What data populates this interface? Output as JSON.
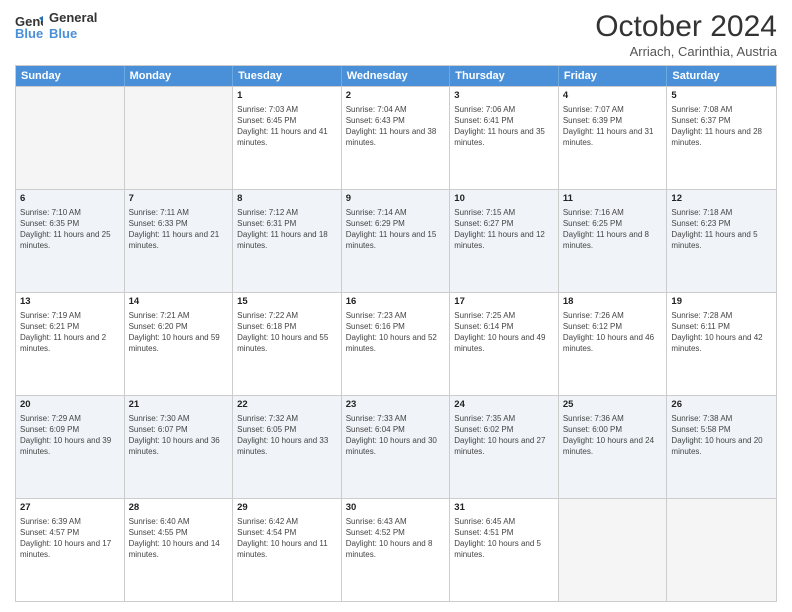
{
  "header": {
    "logo_line1": "General",
    "logo_line2": "Blue",
    "month": "October 2024",
    "location": "Arriach, Carinthia, Austria"
  },
  "weekdays": [
    "Sunday",
    "Monday",
    "Tuesday",
    "Wednesday",
    "Thursday",
    "Friday",
    "Saturday"
  ],
  "rows": [
    [
      {
        "day": "",
        "info": "",
        "empty": true
      },
      {
        "day": "",
        "info": "",
        "empty": true
      },
      {
        "day": "1",
        "info": "Sunrise: 7:03 AM\nSunset: 6:45 PM\nDaylight: 11 hours and 41 minutes."
      },
      {
        "day": "2",
        "info": "Sunrise: 7:04 AM\nSunset: 6:43 PM\nDaylight: 11 hours and 38 minutes."
      },
      {
        "day": "3",
        "info": "Sunrise: 7:06 AM\nSunset: 6:41 PM\nDaylight: 11 hours and 35 minutes."
      },
      {
        "day": "4",
        "info": "Sunrise: 7:07 AM\nSunset: 6:39 PM\nDaylight: 11 hours and 31 minutes."
      },
      {
        "day": "5",
        "info": "Sunrise: 7:08 AM\nSunset: 6:37 PM\nDaylight: 11 hours and 28 minutes."
      }
    ],
    [
      {
        "day": "6",
        "info": "Sunrise: 7:10 AM\nSunset: 6:35 PM\nDaylight: 11 hours and 25 minutes."
      },
      {
        "day": "7",
        "info": "Sunrise: 7:11 AM\nSunset: 6:33 PM\nDaylight: 11 hours and 21 minutes."
      },
      {
        "day": "8",
        "info": "Sunrise: 7:12 AM\nSunset: 6:31 PM\nDaylight: 11 hours and 18 minutes."
      },
      {
        "day": "9",
        "info": "Sunrise: 7:14 AM\nSunset: 6:29 PM\nDaylight: 11 hours and 15 minutes."
      },
      {
        "day": "10",
        "info": "Sunrise: 7:15 AM\nSunset: 6:27 PM\nDaylight: 11 hours and 12 minutes."
      },
      {
        "day": "11",
        "info": "Sunrise: 7:16 AM\nSunset: 6:25 PM\nDaylight: 11 hours and 8 minutes."
      },
      {
        "day": "12",
        "info": "Sunrise: 7:18 AM\nSunset: 6:23 PM\nDaylight: 11 hours and 5 minutes."
      }
    ],
    [
      {
        "day": "13",
        "info": "Sunrise: 7:19 AM\nSunset: 6:21 PM\nDaylight: 11 hours and 2 minutes."
      },
      {
        "day": "14",
        "info": "Sunrise: 7:21 AM\nSunset: 6:20 PM\nDaylight: 10 hours and 59 minutes."
      },
      {
        "day": "15",
        "info": "Sunrise: 7:22 AM\nSunset: 6:18 PM\nDaylight: 10 hours and 55 minutes."
      },
      {
        "day": "16",
        "info": "Sunrise: 7:23 AM\nSunset: 6:16 PM\nDaylight: 10 hours and 52 minutes."
      },
      {
        "day": "17",
        "info": "Sunrise: 7:25 AM\nSunset: 6:14 PM\nDaylight: 10 hours and 49 minutes."
      },
      {
        "day": "18",
        "info": "Sunrise: 7:26 AM\nSunset: 6:12 PM\nDaylight: 10 hours and 46 minutes."
      },
      {
        "day": "19",
        "info": "Sunrise: 7:28 AM\nSunset: 6:11 PM\nDaylight: 10 hours and 42 minutes."
      }
    ],
    [
      {
        "day": "20",
        "info": "Sunrise: 7:29 AM\nSunset: 6:09 PM\nDaylight: 10 hours and 39 minutes."
      },
      {
        "day": "21",
        "info": "Sunrise: 7:30 AM\nSunset: 6:07 PM\nDaylight: 10 hours and 36 minutes."
      },
      {
        "day": "22",
        "info": "Sunrise: 7:32 AM\nSunset: 6:05 PM\nDaylight: 10 hours and 33 minutes."
      },
      {
        "day": "23",
        "info": "Sunrise: 7:33 AM\nSunset: 6:04 PM\nDaylight: 10 hours and 30 minutes."
      },
      {
        "day": "24",
        "info": "Sunrise: 7:35 AM\nSunset: 6:02 PM\nDaylight: 10 hours and 27 minutes."
      },
      {
        "day": "25",
        "info": "Sunrise: 7:36 AM\nSunset: 6:00 PM\nDaylight: 10 hours and 24 minutes."
      },
      {
        "day": "26",
        "info": "Sunrise: 7:38 AM\nSunset: 5:58 PM\nDaylight: 10 hours and 20 minutes."
      }
    ],
    [
      {
        "day": "27",
        "info": "Sunrise: 6:39 AM\nSunset: 4:57 PM\nDaylight: 10 hours and 17 minutes."
      },
      {
        "day": "28",
        "info": "Sunrise: 6:40 AM\nSunset: 4:55 PM\nDaylight: 10 hours and 14 minutes."
      },
      {
        "day": "29",
        "info": "Sunrise: 6:42 AM\nSunset: 4:54 PM\nDaylight: 10 hours and 11 minutes."
      },
      {
        "day": "30",
        "info": "Sunrise: 6:43 AM\nSunset: 4:52 PM\nDaylight: 10 hours and 8 minutes."
      },
      {
        "day": "31",
        "info": "Sunrise: 6:45 AM\nSunset: 4:51 PM\nDaylight: 10 hours and 5 minutes."
      },
      {
        "day": "",
        "info": "",
        "empty": true
      },
      {
        "day": "",
        "info": "",
        "empty": true
      }
    ]
  ]
}
